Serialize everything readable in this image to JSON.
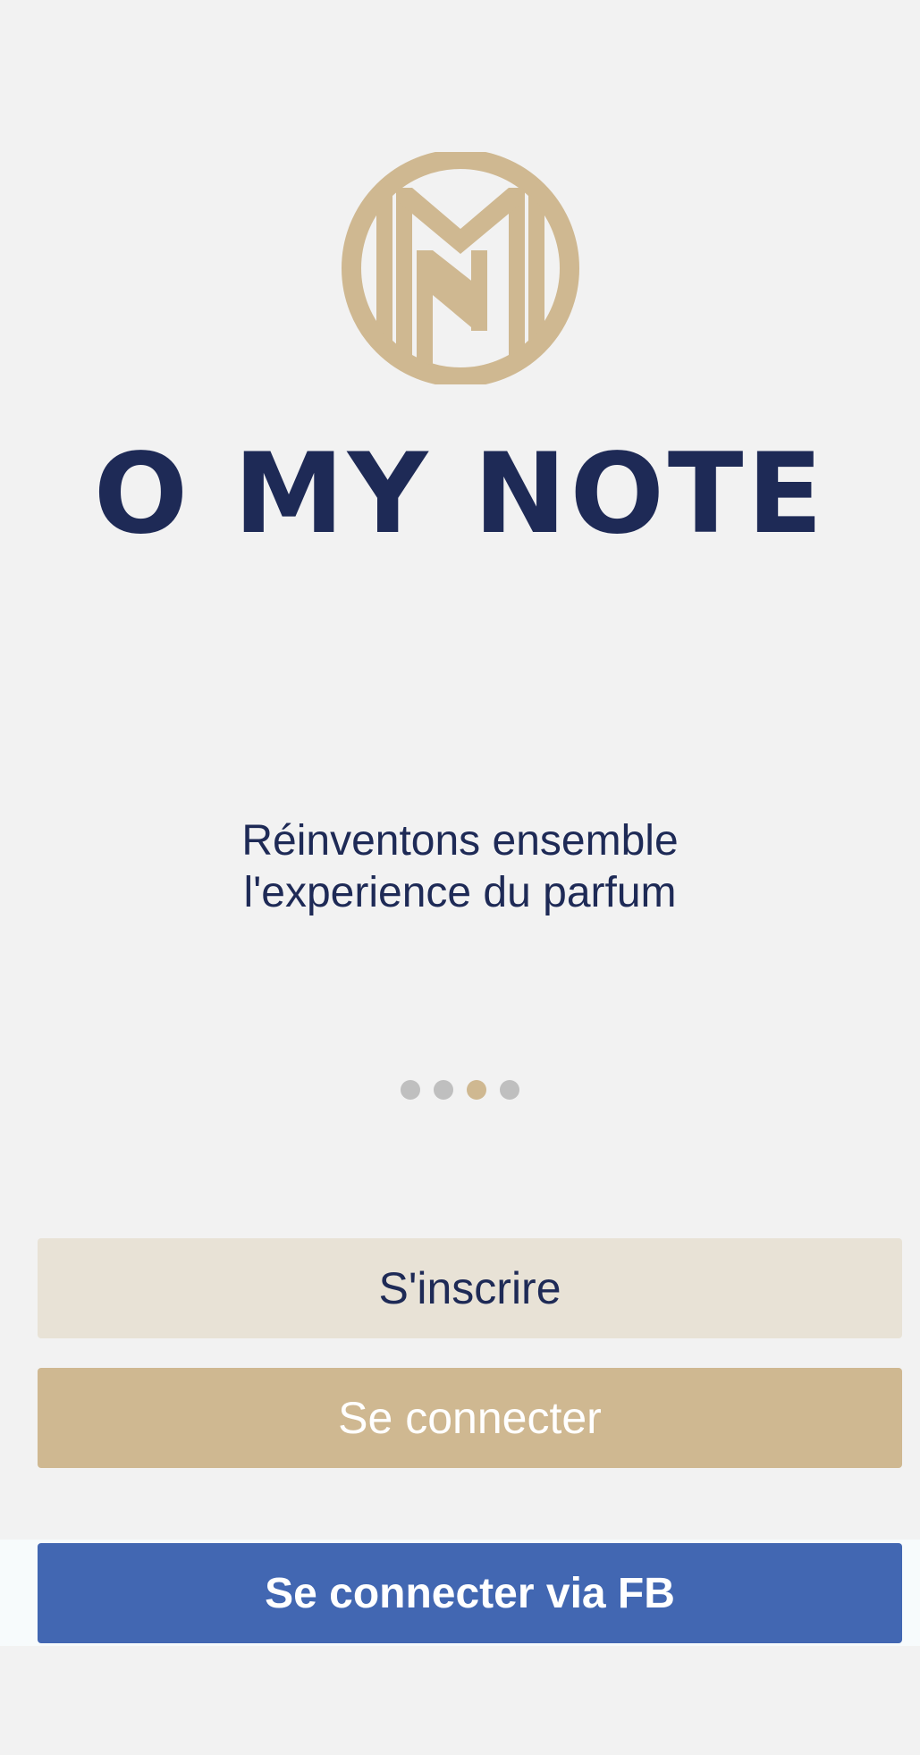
{
  "logo": {
    "icon": "om-monogram-icon",
    "color": "#cfb891"
  },
  "brand": {
    "name": "O MY NOTE",
    "color": "#1e2a56"
  },
  "tagline": {
    "line1": "Réinventons ensemble",
    "line2": "l'experience du parfum"
  },
  "carousel": {
    "pages": 4,
    "active_index": 2,
    "active_color": "#cfb891",
    "inactive_color": "#bfbfbf"
  },
  "actions": {
    "register_label": "S'inscrire",
    "login_label": "Se connecter",
    "facebook_label": "Se connecter via FB",
    "facebook_color": "#4267b2"
  }
}
